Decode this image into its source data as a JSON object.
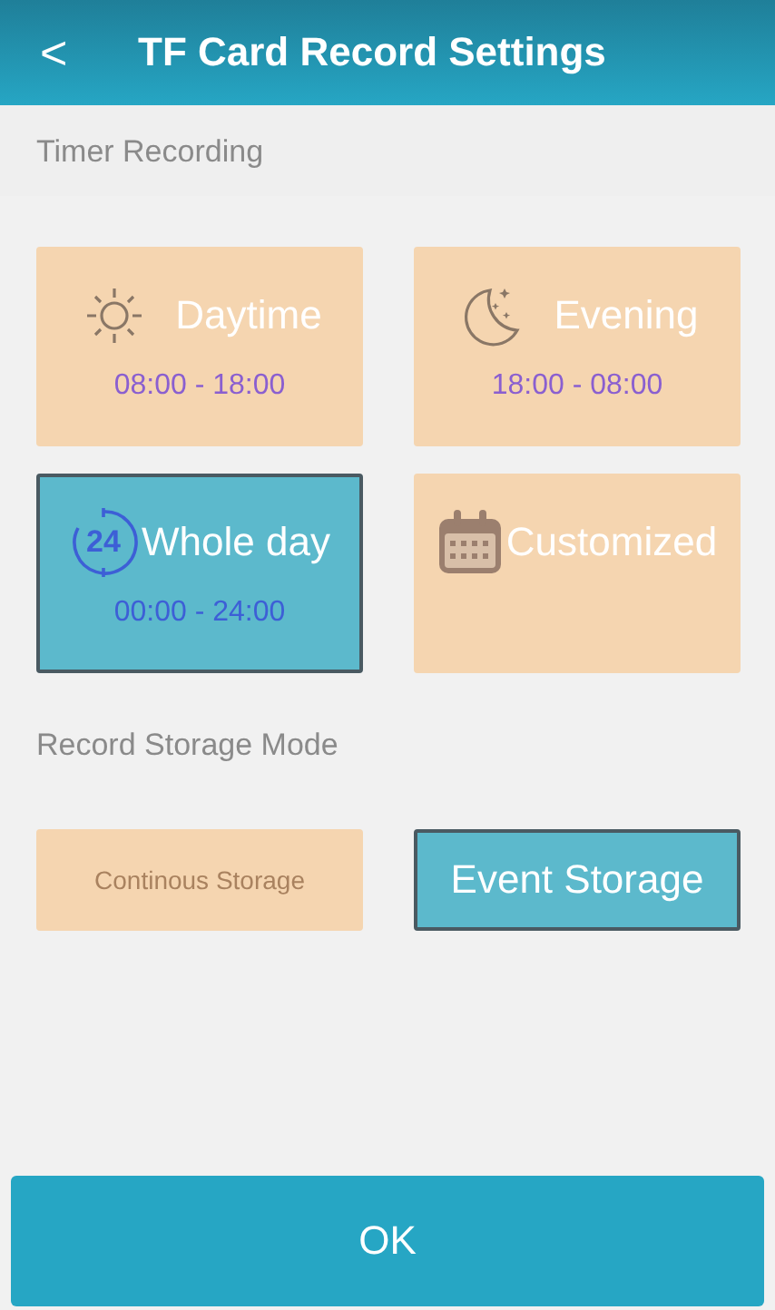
{
  "header": {
    "back": "<",
    "title": "TF Card Record Settings"
  },
  "timer": {
    "label": "Timer Recording",
    "options": [
      {
        "kind": "sun",
        "label": "Daytime",
        "time": "08:00 - 18:00",
        "selected": false
      },
      {
        "kind": "moon",
        "label": "Evening",
        "time": "18:00 - 08:00",
        "selected": false
      },
      {
        "kind": "clock24",
        "icon_text": "24",
        "label": "Whole day",
        "time": "00:00 - 24:00",
        "selected": true
      },
      {
        "kind": "calendar",
        "label": "Customized",
        "selected": false
      }
    ]
  },
  "storage": {
    "label": "Record Storage Mode",
    "options": [
      {
        "label": "Continous Storage",
        "selected": false
      },
      {
        "label": "Event Storage",
        "selected": true
      }
    ]
  },
  "ok": "OK"
}
